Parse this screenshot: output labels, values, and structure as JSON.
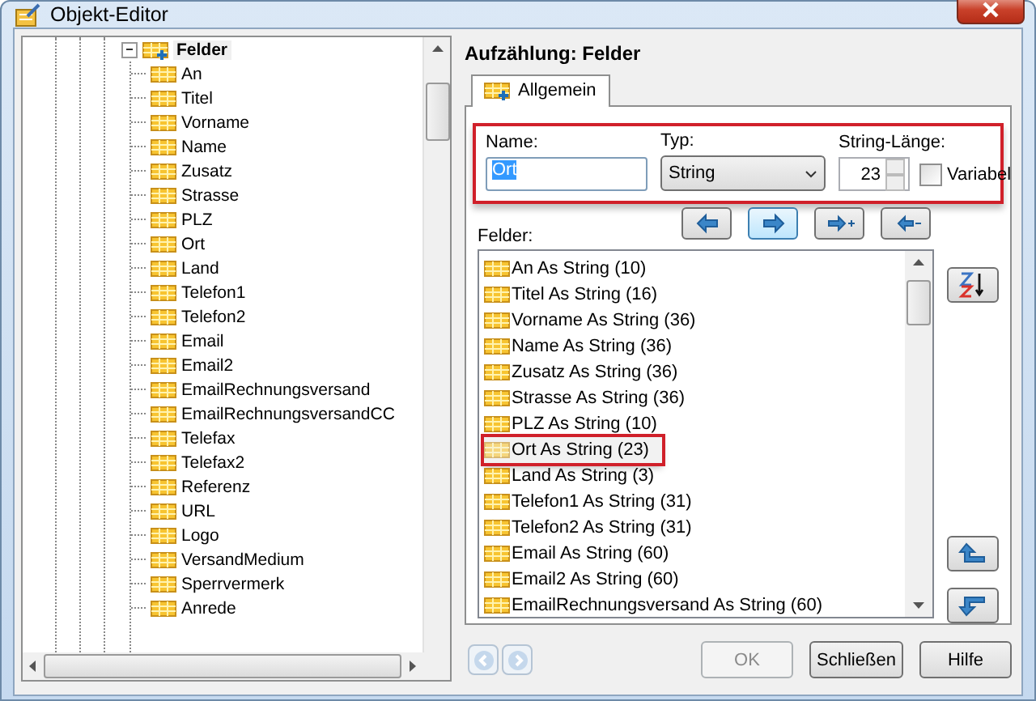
{
  "window": {
    "title": "Objekt-Editor"
  },
  "tree": {
    "label": "Felder",
    "expanded": true,
    "children": [
      {
        "label": "An"
      },
      {
        "label": "Titel"
      },
      {
        "label": "Vorname"
      },
      {
        "label": "Name"
      },
      {
        "label": "Zusatz"
      },
      {
        "label": "Strasse"
      },
      {
        "label": "PLZ"
      },
      {
        "label": "Ort"
      },
      {
        "label": "Land"
      },
      {
        "label": "Telefon1"
      },
      {
        "label": "Telefon2"
      },
      {
        "label": "Email"
      },
      {
        "label": "Email2"
      },
      {
        "label": "EmailRechnungsversand"
      },
      {
        "label": "EmailRechnungsversandCC"
      },
      {
        "label": "Telefax"
      },
      {
        "label": "Telefax2"
      },
      {
        "label": "Referenz"
      },
      {
        "label": "URL"
      },
      {
        "label": "Logo"
      },
      {
        "label": "VersandMedium"
      },
      {
        "label": "Sperrvermerk"
      },
      {
        "label": "Anrede"
      }
    ]
  },
  "editor": {
    "heading": "Aufzählung: Felder",
    "tabs": [
      {
        "label": "Allgemein",
        "selected": true
      }
    ],
    "properties": {
      "highlighted": true,
      "name_label": "Name:",
      "name_value": "Ort",
      "type_label": "Typ:",
      "type_value": "String",
      "length_label": "String-Länge:",
      "length_value": "23",
      "variable_label": "Variabel",
      "variable_checked": false
    },
    "toolbar": [
      {
        "kind": "left",
        "focused": false
      },
      {
        "kind": "right",
        "focused": true
      },
      {
        "kind": "add",
        "focused": false
      },
      {
        "kind": "remove",
        "focused": false
      }
    ],
    "fields_label": "Felder:",
    "fields": [
      {
        "label": "An As String (10)",
        "selected": false,
        "highlighted": false
      },
      {
        "label": "Titel As String (16)",
        "selected": false,
        "highlighted": false
      },
      {
        "label": "Vorname As String (36)",
        "selected": false,
        "highlighted": false
      },
      {
        "label": "Name As String (36)",
        "selected": false,
        "highlighted": false
      },
      {
        "label": "Zusatz As String (36)",
        "selected": false,
        "highlighted": false
      },
      {
        "label": "Strasse As String (36)",
        "selected": false,
        "highlighted": false
      },
      {
        "label": "PLZ As String (10)",
        "selected": false,
        "highlighted": false
      },
      {
        "label": "Ort As String (23)",
        "selected": true,
        "highlighted": true
      },
      {
        "label": "Land As String (3)",
        "selected": false,
        "highlighted": false
      },
      {
        "label": "Telefon1 As String (31)",
        "selected": false,
        "highlighted": false
      },
      {
        "label": "Telefon2 As String (31)",
        "selected": false,
        "highlighted": false
      },
      {
        "label": "Email As String (60)",
        "selected": false,
        "highlighted": false
      },
      {
        "label": "Email2 As String (60)",
        "selected": false,
        "highlighted": false
      },
      {
        "label": "EmailRechnungsversand As String (60)",
        "selected": false,
        "highlighted": false
      }
    ]
  },
  "buttons": [
    {
      "label": "OK",
      "disabled": true
    },
    {
      "label": "Schließen",
      "disabled": false
    },
    {
      "label": "Hilfe",
      "disabled": false
    }
  ]
}
